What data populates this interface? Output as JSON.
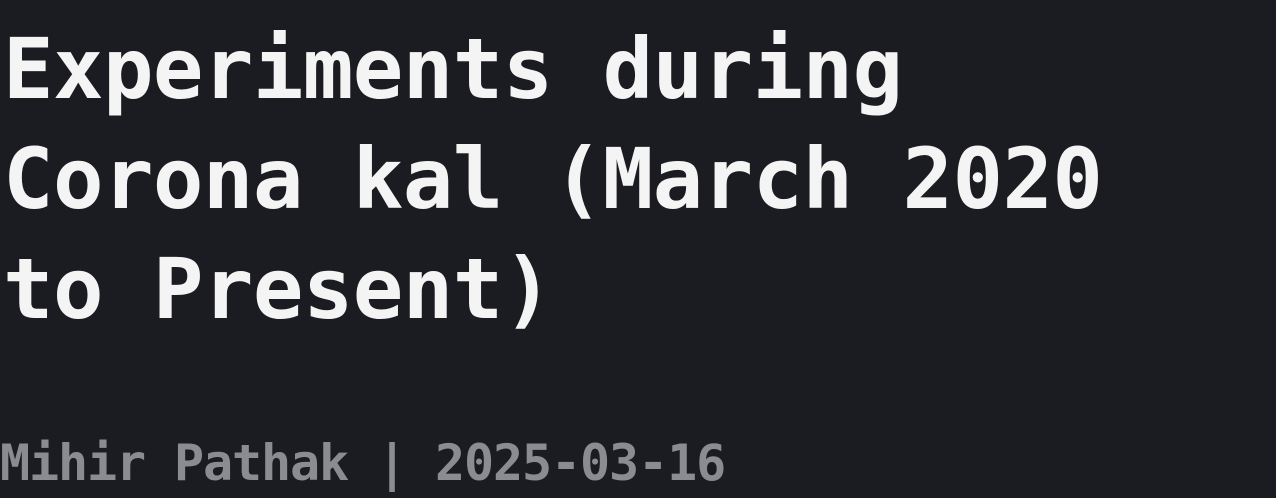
{
  "article": {
    "title_lines": [
      "Experiments during",
      "Corona kal (March 2020",
      "to Present)"
    ],
    "author": "Mihir Pathak",
    "separator": " | ",
    "date": "2025-03-16"
  },
  "colors": {
    "background": "#1b1c21",
    "title": "#f4f4f4",
    "meta": "#8b8c8f"
  }
}
